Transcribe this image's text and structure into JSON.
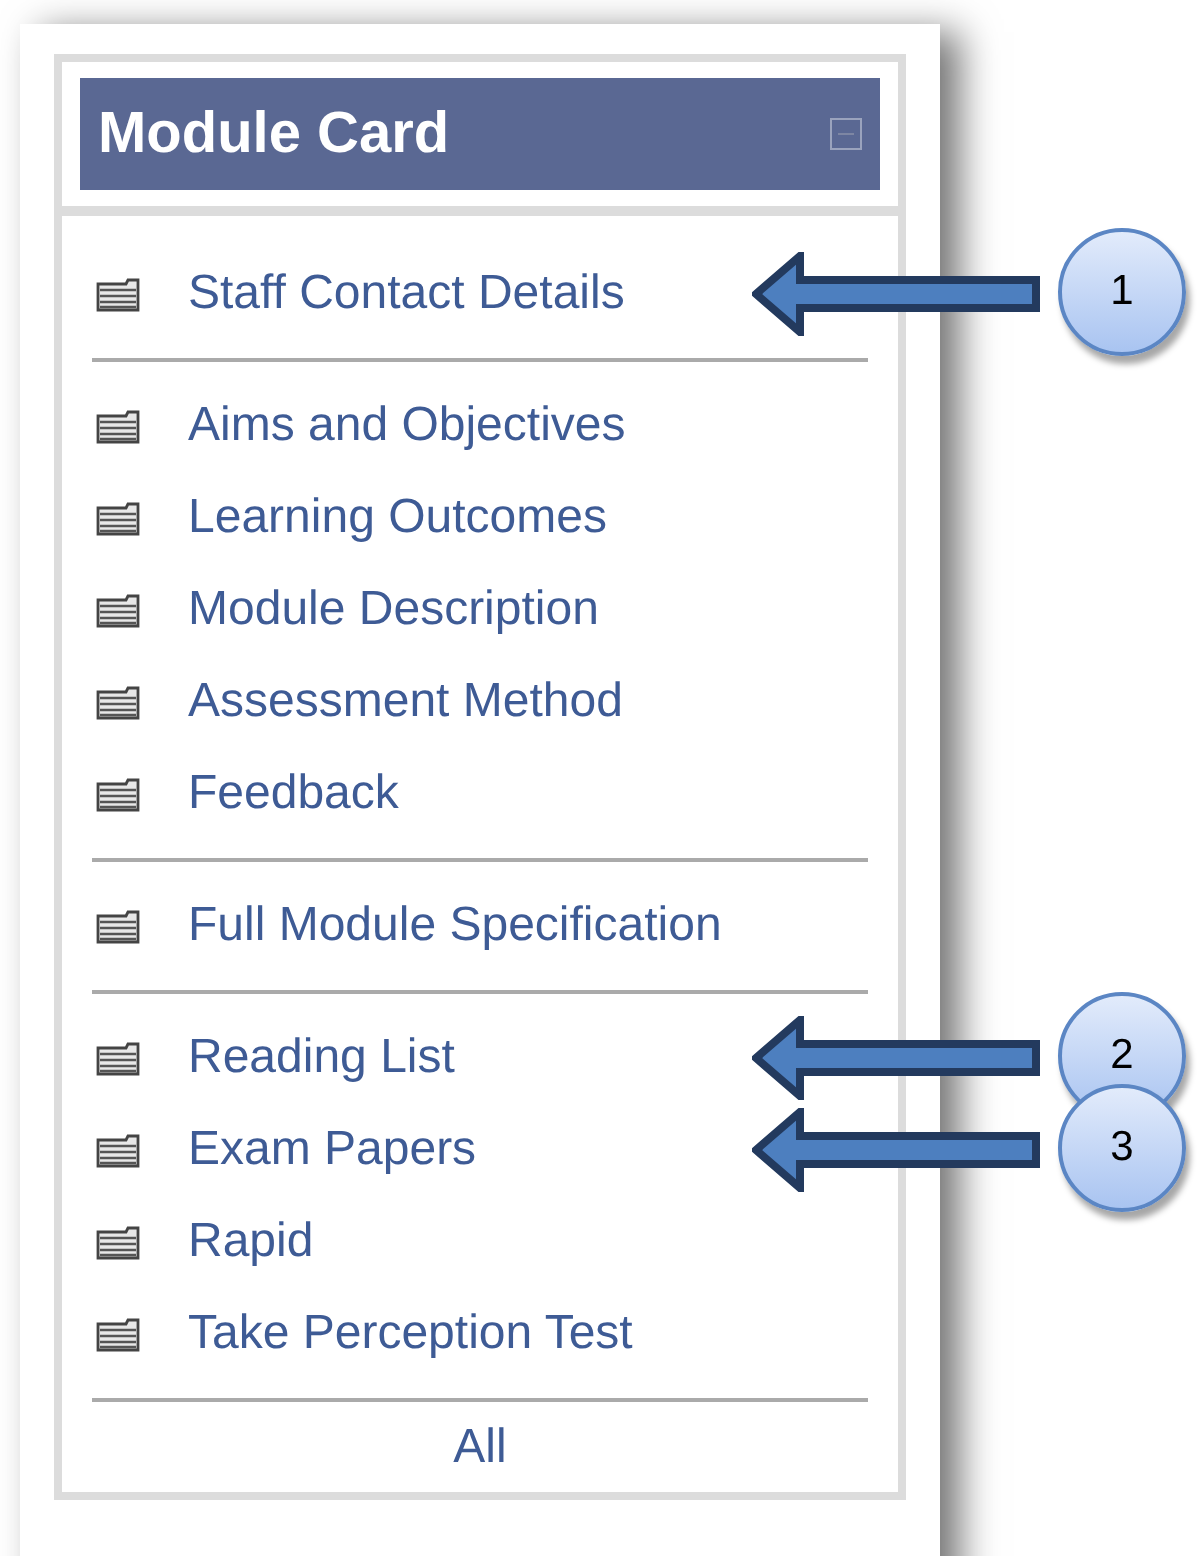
{
  "module_card": {
    "title": "Module Card",
    "groups": [
      {
        "items": [
          {
            "label": "Staff Contact Details",
            "callout": "1"
          }
        ]
      },
      {
        "items": [
          {
            "label": "Aims and Objectives"
          },
          {
            "label": "Learning Outcomes"
          },
          {
            "label": "Module Description"
          },
          {
            "label": "Assessment Method"
          },
          {
            "label": "Feedback"
          }
        ]
      },
      {
        "items": [
          {
            "label": "Full Module Specification"
          }
        ]
      },
      {
        "items": [
          {
            "label": "Reading List",
            "callout": "2"
          },
          {
            "label": "Exam Papers",
            "callout": "3"
          },
          {
            "label": "Rapid"
          },
          {
            "label": "Take Perception Test"
          }
        ]
      }
    ],
    "footer_link": "All"
  }
}
